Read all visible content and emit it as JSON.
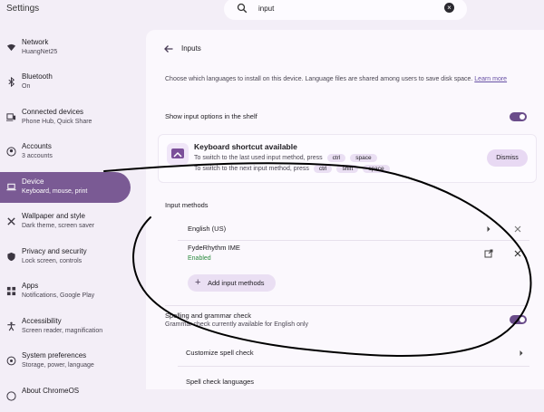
{
  "app": {
    "title": "Settings"
  },
  "search": {
    "value": "input",
    "placeholder": ""
  },
  "sidebar": {
    "items": [
      {
        "label": "Network",
        "sub": "HuangNet25",
        "icon": "wifi-icon"
      },
      {
        "label": "Bluetooth",
        "sub": "On",
        "icon": "bluetooth-icon"
      },
      {
        "label": "Connected devices",
        "sub": "Phone Hub, Quick Share",
        "icon": "devices-icon"
      },
      {
        "label": "Accounts",
        "sub": "3 accounts",
        "icon": "account-icon"
      },
      {
        "label": "Device",
        "sub": "Keyboard, mouse, print",
        "icon": "laptop-icon",
        "selected": true
      },
      {
        "label": "Wallpaper and style",
        "sub": "Dark theme, screen saver",
        "icon": "palette-icon"
      },
      {
        "label": "Privacy and security",
        "sub": "Lock screen, controls",
        "icon": "shield-icon"
      },
      {
        "label": "Apps",
        "sub": "Notifications, Google Play",
        "icon": "apps-grid-icon"
      },
      {
        "label": "Accessibility",
        "sub": "Screen reader, magnification",
        "icon": "accessibility-icon"
      },
      {
        "label": "System preferences",
        "sub": "Storage, power, language",
        "icon": "system-icon"
      },
      {
        "label": "About ChromeOS",
        "sub": "",
        "icon": "info-icon"
      }
    ]
  },
  "page": {
    "title": "Inputs",
    "description": "Choose which languages to install on this device. Language files are shared among users to save disk space.",
    "learn_more": "Learn more",
    "show_options_label": "Show input options in the shelf",
    "show_options_on": true
  },
  "shortcut_card": {
    "title": "Keyboard shortcut available",
    "line1_text": "To switch to the last used input method, press",
    "line1_keys": [
      "ctrl",
      "space"
    ],
    "line2_text": "To switch to the next input method, press",
    "line2_keys": [
      "ctrl",
      "shift",
      "space"
    ],
    "dismiss_label": "Dismiss"
  },
  "input_methods": {
    "heading": "Input methods",
    "items": [
      {
        "name": "English (US)",
        "status": ""
      },
      {
        "name": "FydeRhythm IME",
        "status": "Enabled"
      }
    ],
    "add_label": "Add input methods"
  },
  "spell": {
    "title": "Spelling and grammar check",
    "subtitle": "Grammar check currently available for English only",
    "on": true,
    "customize_label": "Customize spell check",
    "languages_label": "Spell check languages"
  },
  "colors": {
    "accent": "#6a4c8a",
    "selected_nav": "#7a5a94",
    "enabled_text": "#2b8a3e",
    "annotation_stroke": "#000000"
  }
}
